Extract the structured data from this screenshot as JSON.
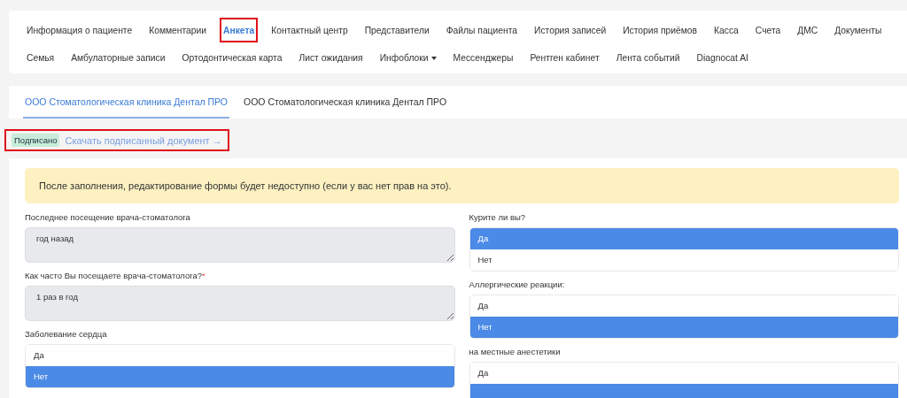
{
  "nav_tabs": [
    {
      "label": "Информация о пациенте",
      "selected": false,
      "highlighted": false
    },
    {
      "label": "Комментарии",
      "selected": false,
      "highlighted": false
    },
    {
      "label": "Анкета",
      "selected": true,
      "highlighted": true
    },
    {
      "label": "Контактный центр",
      "selected": false,
      "highlighted": false
    },
    {
      "label": "Представители",
      "selected": false,
      "highlighted": false
    },
    {
      "label": "Файлы пациента",
      "selected": false,
      "highlighted": false
    },
    {
      "label": "История записей",
      "selected": false,
      "highlighted": false
    },
    {
      "label": "История приёмов",
      "selected": false,
      "highlighted": false
    },
    {
      "label": "Касса",
      "selected": false,
      "highlighted": false
    },
    {
      "label": "Счета",
      "selected": false,
      "highlighted": false
    },
    {
      "label": "ДМС",
      "selected": false,
      "highlighted": false
    },
    {
      "label": "Документы",
      "selected": false,
      "highlighted": false
    },
    {
      "label": "Семья",
      "selected": false,
      "highlighted": false
    },
    {
      "label": "Амбулаторные записи",
      "selected": false,
      "highlighted": false
    },
    {
      "label": "Ортодонтическая карта",
      "selected": false,
      "highlighted": false
    },
    {
      "label": "Лист ожидания",
      "selected": false,
      "highlighted": false
    },
    {
      "label": "Инфоблоки",
      "selected": false,
      "highlighted": false,
      "dropdown": true
    },
    {
      "label": "Мессенджеры",
      "selected": false,
      "highlighted": false
    },
    {
      "label": "Рентген кабинет",
      "selected": false,
      "highlighted": false
    },
    {
      "label": "Лента событий",
      "selected": false,
      "highlighted": false
    },
    {
      "label": "Diagnocat AI",
      "selected": false,
      "highlighted": false
    }
  ],
  "clinic_tabs": [
    {
      "label": "ООО Стоматологическая клиника Дентал ПРО",
      "selected": true
    },
    {
      "label": "ООО Стоматологическая клиника Дентал ПРО",
      "selected": false
    }
  ],
  "status": {
    "badge": "Подписано",
    "link": "Скачать подписанный документ →",
    "highlighted": true
  },
  "alert": "После заполнения, редактирование формы будет недоступно (если у вас нет прав на это).",
  "columns": [
    [
      {
        "kind": "text",
        "label": "Последнее посещение врача-стоматолога",
        "value": "год назад"
      },
      {
        "kind": "text",
        "label": "Как часто Вы посещаете врача-стоматолога?",
        "required_mark": "*",
        "value": "1 раз в год"
      },
      {
        "kind": "choice",
        "label": "Заболевание сердца",
        "options": [
          {
            "label": "Да",
            "selected": false
          },
          {
            "label": "Нет",
            "selected": true
          }
        ]
      }
    ],
    [
      {
        "kind": "choice",
        "label": "Курите ли вы?",
        "options": [
          {
            "label": "Да",
            "selected": true
          },
          {
            "label": "Нет",
            "selected": false
          }
        ]
      },
      {
        "kind": "choice",
        "label": "Аллергические реакции:",
        "options": [
          {
            "label": "Да",
            "selected": false
          },
          {
            "label": "Нет",
            "selected": true
          }
        ]
      },
      {
        "kind": "choice",
        "label": "на местные анестетики",
        "options": [
          {
            "label": "Да",
            "selected": false
          },
          {
            "selected": true
          }
        ]
      }
    ]
  ]
}
